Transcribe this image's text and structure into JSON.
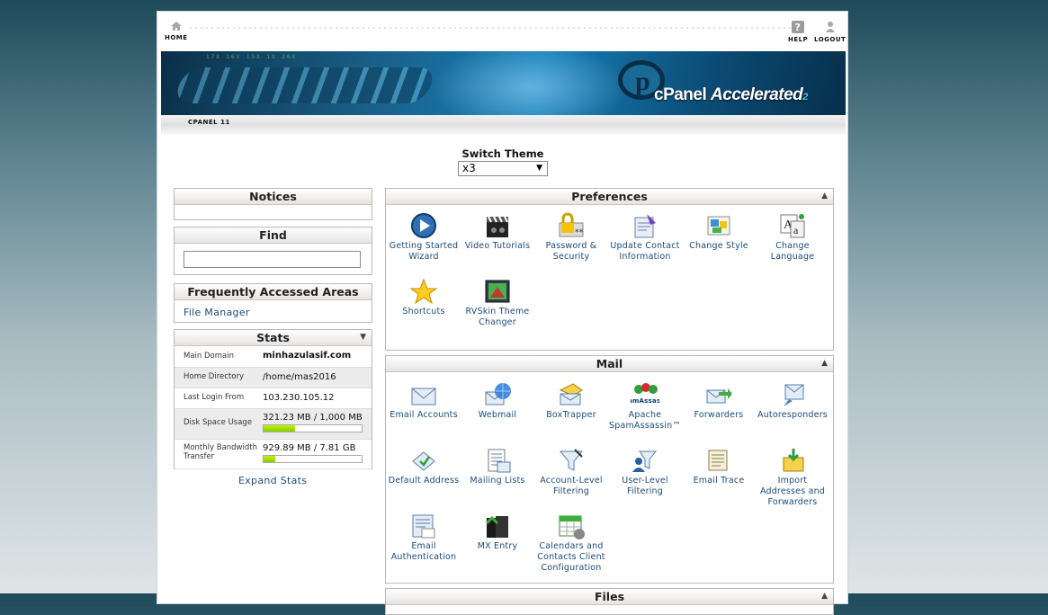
{
  "topbar": {
    "home_label": "HOME",
    "help_label": "HELP",
    "logout_label": "LOGOUT"
  },
  "banner": {
    "brand": "cPanel",
    "accelerated": "Accelerated",
    "version_suffix": "2",
    "binary": "17X  16X  15X  1X  20X"
  },
  "strip": {
    "label": "CPANEL 11"
  },
  "switch_theme": {
    "label": "Switch Theme",
    "selected": "x3"
  },
  "notices": {
    "title": "Notices"
  },
  "find": {
    "title": "Find",
    "value": ""
  },
  "faa": {
    "title": "Frequently Accessed Areas",
    "link": "File Manager"
  },
  "stats": {
    "title": "Stats",
    "rows": [
      {
        "label": "Main Domain",
        "value": "minhazulasif.com"
      },
      {
        "label": "Home Directory",
        "value": "/home/mas2016"
      },
      {
        "label": "Last Login From",
        "value": "103.230.105.12"
      },
      {
        "label": "Disk Space Usage",
        "value": "321.23 MB / 1,000 MB",
        "fraction": 0.32
      },
      {
        "label": "Monthly Bandwidth Transfer",
        "value": "929.89 MB / 7.81 GB",
        "fraction": 0.12
      }
    ],
    "expand": "Expand Stats"
  },
  "preferences": {
    "title": "Preferences",
    "items": [
      {
        "label": "Getting Started Wizard",
        "icon": "play-icon"
      },
      {
        "label": "Video Tutorials",
        "icon": "clapper-icon"
      },
      {
        "label": "Password & Security",
        "icon": "lock-icon"
      },
      {
        "label": "Update Contact Information",
        "icon": "contact-icon"
      },
      {
        "label": "Change Style",
        "icon": "style-icon"
      },
      {
        "label": "Change Language",
        "icon": "language-icon"
      },
      {
        "label": "Shortcuts",
        "icon": "star-icon"
      },
      {
        "label": "RVSkin Theme Changer",
        "icon": "theme-icon"
      }
    ]
  },
  "mail": {
    "title": "Mail",
    "items": [
      {
        "label": "Email Accounts",
        "icon": "envelope-icon"
      },
      {
        "label": "Webmail",
        "icon": "globe-mail-icon"
      },
      {
        "label": "BoxTrapper",
        "icon": "boxtrapper-icon"
      },
      {
        "label": "Apache SpamAssassin™",
        "icon": "spamassassin-icon",
        "logo_text": "SpamAssassin"
      },
      {
        "label": "Forwarders",
        "icon": "forward-icon"
      },
      {
        "label": "Autoresponders",
        "icon": "autoresponder-icon"
      },
      {
        "label": "Default Address",
        "icon": "default-address-icon"
      },
      {
        "label": "Mailing Lists",
        "icon": "mailing-list-icon"
      },
      {
        "label": "Account-Level Filtering",
        "icon": "filter-icon"
      },
      {
        "label": "User-Level Filtering",
        "icon": "user-filter-icon"
      },
      {
        "label": "Email Trace",
        "icon": "trace-icon"
      },
      {
        "label": "Import Addresses and Forwarders",
        "icon": "import-icon"
      },
      {
        "label": "Email Authentication",
        "icon": "auth-icon"
      },
      {
        "label": "MX Entry",
        "icon": "mx-icon"
      },
      {
        "label": "Calendars and Contacts Client Configuration",
        "icon": "calendar-icon"
      }
    ]
  },
  "files": {
    "title": "Files"
  },
  "colors": {
    "link": "#1c4c7a",
    "bar_fill": "#9fe000",
    "header_bg": "#e8e4e0"
  }
}
